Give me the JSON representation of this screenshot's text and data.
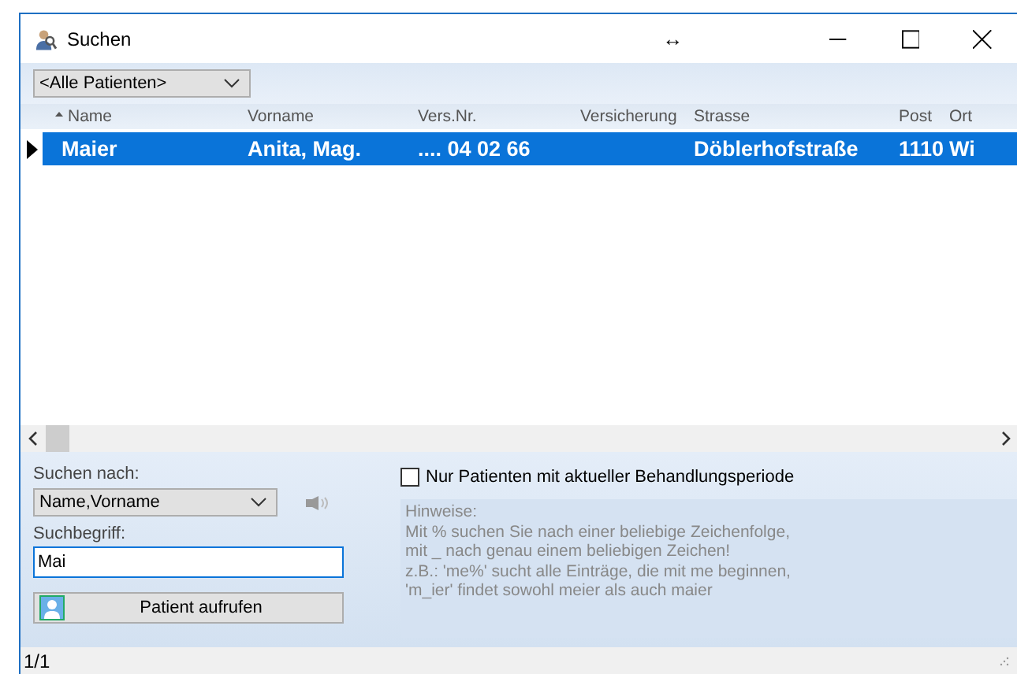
{
  "window": {
    "title": "Suchen",
    "resize_glyph": "↔"
  },
  "filter": {
    "value": "<Alle Patienten>"
  },
  "table": {
    "columns": [
      "Name",
      "Vorname",
      "Vers.Nr.",
      "Versicherung",
      "Strasse",
      "Post",
      "Ort"
    ],
    "rows": [
      {
        "selected": true,
        "cells": [
          "Maier",
          "Anita, Mag.",
          ".... 04 02 66",
          "",
          "Döblerhofstraße",
          "1110",
          "Wi"
        ]
      }
    ]
  },
  "search": {
    "by_label": "Suchen nach:",
    "by_value": "Name,Vorname",
    "term_label": "Suchbegriff:",
    "term_value": "Mai",
    "open_button": "Patient aufrufen"
  },
  "only_current": {
    "label": "Nur Patienten mit aktueller Behandlungsperiode",
    "checked": false
  },
  "hints": "Hinweise:\nMit % suchen Sie nach einer beliebige Zeichenfolge,\nmit _ nach genau einem beliebigen Zeichen!\nz.B.: 'me%' sucht alle Einträge, die mit me beginnen,\n'm_ier' findet sowohl meier als auch maier",
  "status_bar": {
    "count": "1/1"
  }
}
